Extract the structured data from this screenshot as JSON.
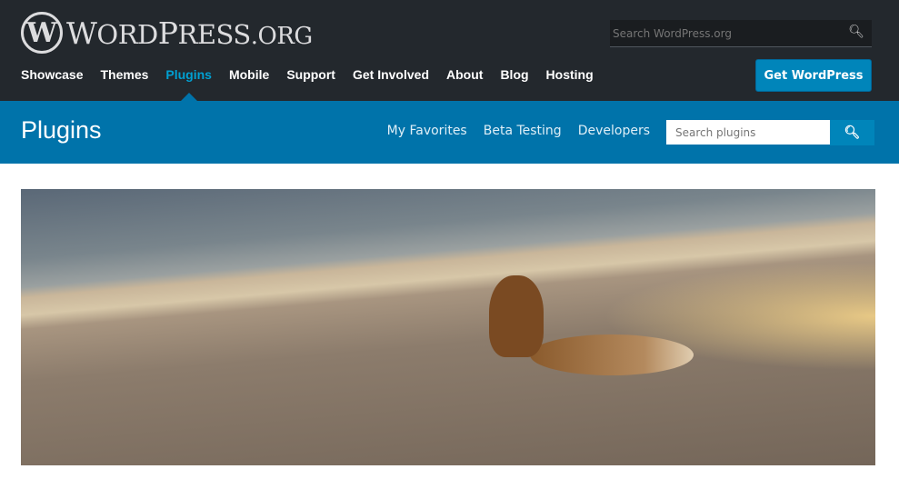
{
  "header": {
    "logo_mark": "W",
    "logo_text": "WordPress.org",
    "search_placeholder": "Search WordPress.org",
    "get_wordpress": "Get WordPress",
    "nav": [
      {
        "label": "Showcase"
      },
      {
        "label": "Themes"
      },
      {
        "label": "Plugins",
        "active": true
      },
      {
        "label": "Mobile"
      },
      {
        "label": "Support"
      },
      {
        "label": "Get Involved"
      },
      {
        "label": "About"
      },
      {
        "label": "Blog"
      },
      {
        "label": "Hosting"
      }
    ]
  },
  "plugins_bar": {
    "title": "Plugins",
    "links": [
      "My Favorites",
      "Beta Testing",
      "Developers"
    ],
    "search_placeholder": "Search plugins"
  },
  "colors": {
    "header_bg": "#23282d",
    "accent": "#0073aa",
    "active_nav": "#00a0d2",
    "button": "#0085ba"
  },
  "icons": {
    "search": "search-icon"
  }
}
